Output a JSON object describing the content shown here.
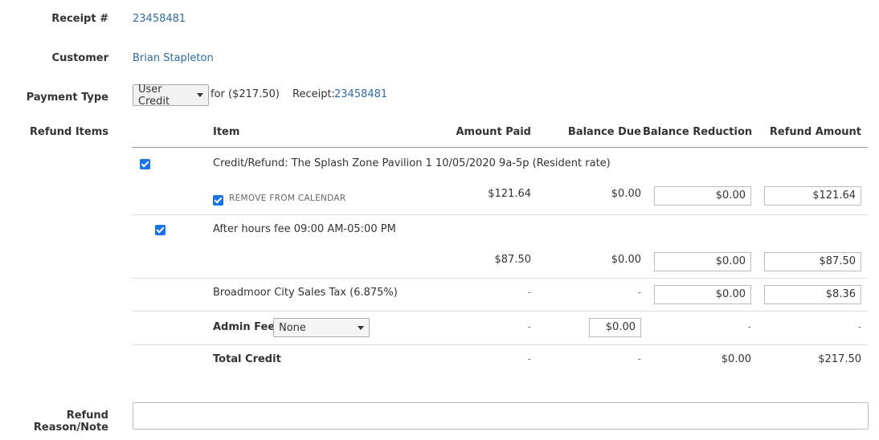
{
  "receipt": {
    "label": "Receipt #",
    "value": "23458481"
  },
  "customer": {
    "label": "Customer",
    "value": "Brian Stapleton"
  },
  "payment": {
    "label": "Payment Type",
    "select_value": "User Credit",
    "for_text": "for ($217.50)",
    "receipt_label": "Receipt:",
    "receipt_value": "23458481"
  },
  "refund_items_label": "Refund Items",
  "table": {
    "headers": [
      "Item",
      "Amount Paid",
      "Balance Due",
      "Balance Reduction",
      "Refund Amount"
    ],
    "rows": [
      {
        "item": "Credit/Refund: The Splash Zone Pavilion 1 10/05/2020 9a-5p (Resident rate)",
        "sub_check_label": "REMOVE FROM CALENDAR",
        "amount_paid": "$121.64",
        "balance_due": "$0.00",
        "balance_reduction": "$0.00",
        "refund_amount": "$121.64"
      },
      {
        "item": "After hours fee 09:00 AM-05:00 PM",
        "amount_paid": "$87.50",
        "balance_due": "$0.00",
        "balance_reduction": "$0.00",
        "refund_amount": "$87.50"
      },
      {
        "item": "Broadmoor City Sales Tax (6.875%)",
        "amount_paid": "-",
        "balance_due": "-",
        "balance_reduction": "$0.00",
        "refund_amount": "$8.36"
      },
      {
        "item_label": "Admin Fee:",
        "select_value": "None",
        "amount_paid": "-",
        "balance_due": "$0.00",
        "balance_reduction": "-",
        "refund_amount": "-"
      },
      {
        "item": "Total Credit",
        "amount_paid": "-",
        "balance_due": "-",
        "balance_reduction": "$0.00",
        "refund_amount": "$217.50"
      }
    ]
  },
  "note": {
    "label": "Refund Reason/Note",
    "value": ""
  },
  "colors": {
    "link": "#2f6ba3",
    "checkbox": "#1a73e8"
  }
}
